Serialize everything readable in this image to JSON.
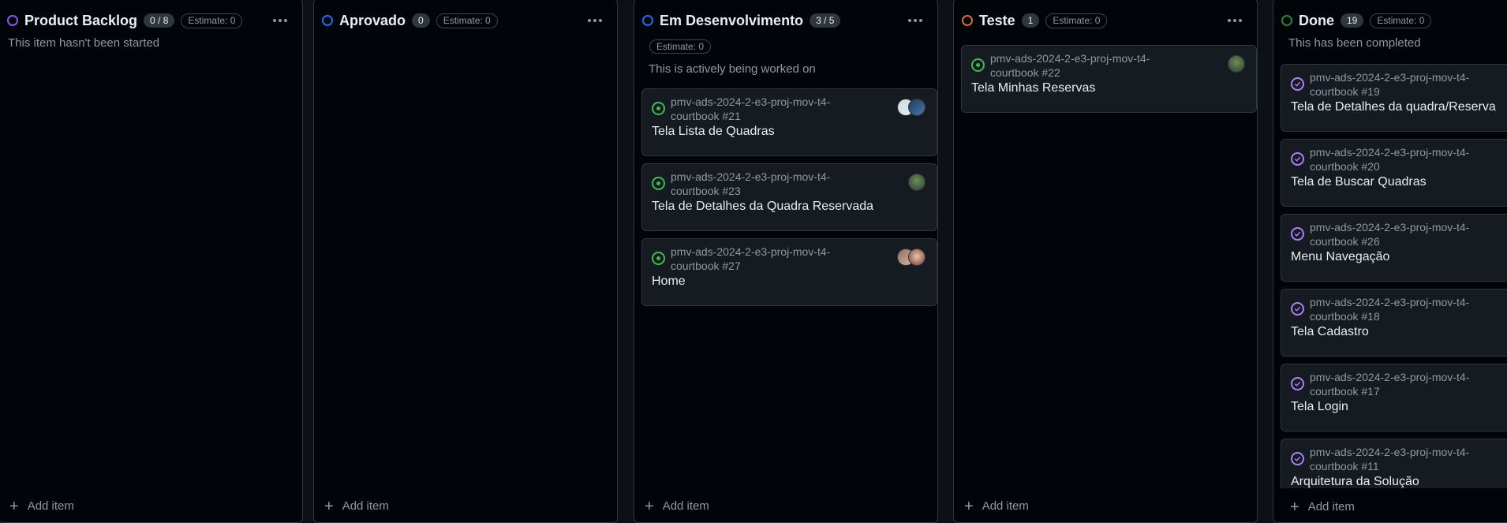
{
  "columns": [
    {
      "title": "Product Backlog",
      "count": "0 / 8",
      "estimate": "Estimate: 0",
      "description": "This item hasn't been started",
      "status_color": "#8957e5",
      "add_item": "Add item",
      "cards": []
    },
    {
      "title": "Aprovado",
      "count": "0",
      "estimate": "Estimate: 0",
      "description": "",
      "status_color": "#1f6feb",
      "add_item": "Add item",
      "cards": []
    },
    {
      "title": "Em Desenvolvimento",
      "count": "3 / 5",
      "estimate": "Estimate: 0",
      "description": "This is actively being worked on",
      "status_color": "#1f6feb",
      "add_item": "Add item",
      "cards": [
        {
          "repo": "pmv-ads-2024-2-e3-proj-mov-t4-courtbook #21",
          "title": "Tela Lista de Quadras",
          "status": "open",
          "avatars": 2
        },
        {
          "repo": "pmv-ads-2024-2-e3-proj-mov-t4-courtbook #23",
          "title": "Tela de Detalhes da Quadra Reservada",
          "status": "open",
          "avatars": 1
        },
        {
          "repo": "pmv-ads-2024-2-e3-proj-mov-t4-courtbook #27",
          "title": "Home",
          "status": "open",
          "avatars": 2
        }
      ]
    },
    {
      "title": "Teste",
      "count": "1",
      "estimate": "Estimate: 0",
      "description": "",
      "status_color": "#db6d28",
      "add_item": "Add item",
      "cards": [
        {
          "repo": "pmv-ads-2024-2-e3-proj-mov-t4-courtbook #22",
          "title": "Tela Minhas Reservas",
          "status": "open",
          "avatars": 1
        }
      ]
    },
    {
      "title": "Done",
      "count": "19",
      "estimate": "Estimate: 0",
      "description": "This has been completed",
      "status_color": "#238636",
      "add_item": "Add item",
      "cards": [
        {
          "repo": "pmv-ads-2024-2-e3-proj-mov-t4-courtbook #19",
          "title": "Tela de Detalhes da quadra/Reserva",
          "status": "done",
          "avatars": 0
        },
        {
          "repo": "pmv-ads-2024-2-e3-proj-mov-t4-courtbook #20",
          "title": "Tela de Buscar Quadras",
          "status": "done",
          "avatars": 0
        },
        {
          "repo": "pmv-ads-2024-2-e3-proj-mov-t4-courtbook #26",
          "title": "Menu Navegação",
          "status": "done",
          "avatars": 0
        },
        {
          "repo": "pmv-ads-2024-2-e3-proj-mov-t4-courtbook #18",
          "title": "Tela Cadastro",
          "status": "done",
          "avatars": 0
        },
        {
          "repo": "pmv-ads-2024-2-e3-proj-mov-t4-courtbook #17",
          "title": "Tela Login",
          "status": "done",
          "avatars": 0
        },
        {
          "repo": "pmv-ads-2024-2-e3-proj-mov-t4-courtbook #11",
          "title": "Arquitetura da Solução",
          "status": "done",
          "avatars": 0
        }
      ]
    }
  ],
  "icons": {
    "open": "issue-open-icon",
    "done": "issue-closed-icon",
    "more": "kebab-horizontal-icon",
    "add": "plus-icon"
  }
}
